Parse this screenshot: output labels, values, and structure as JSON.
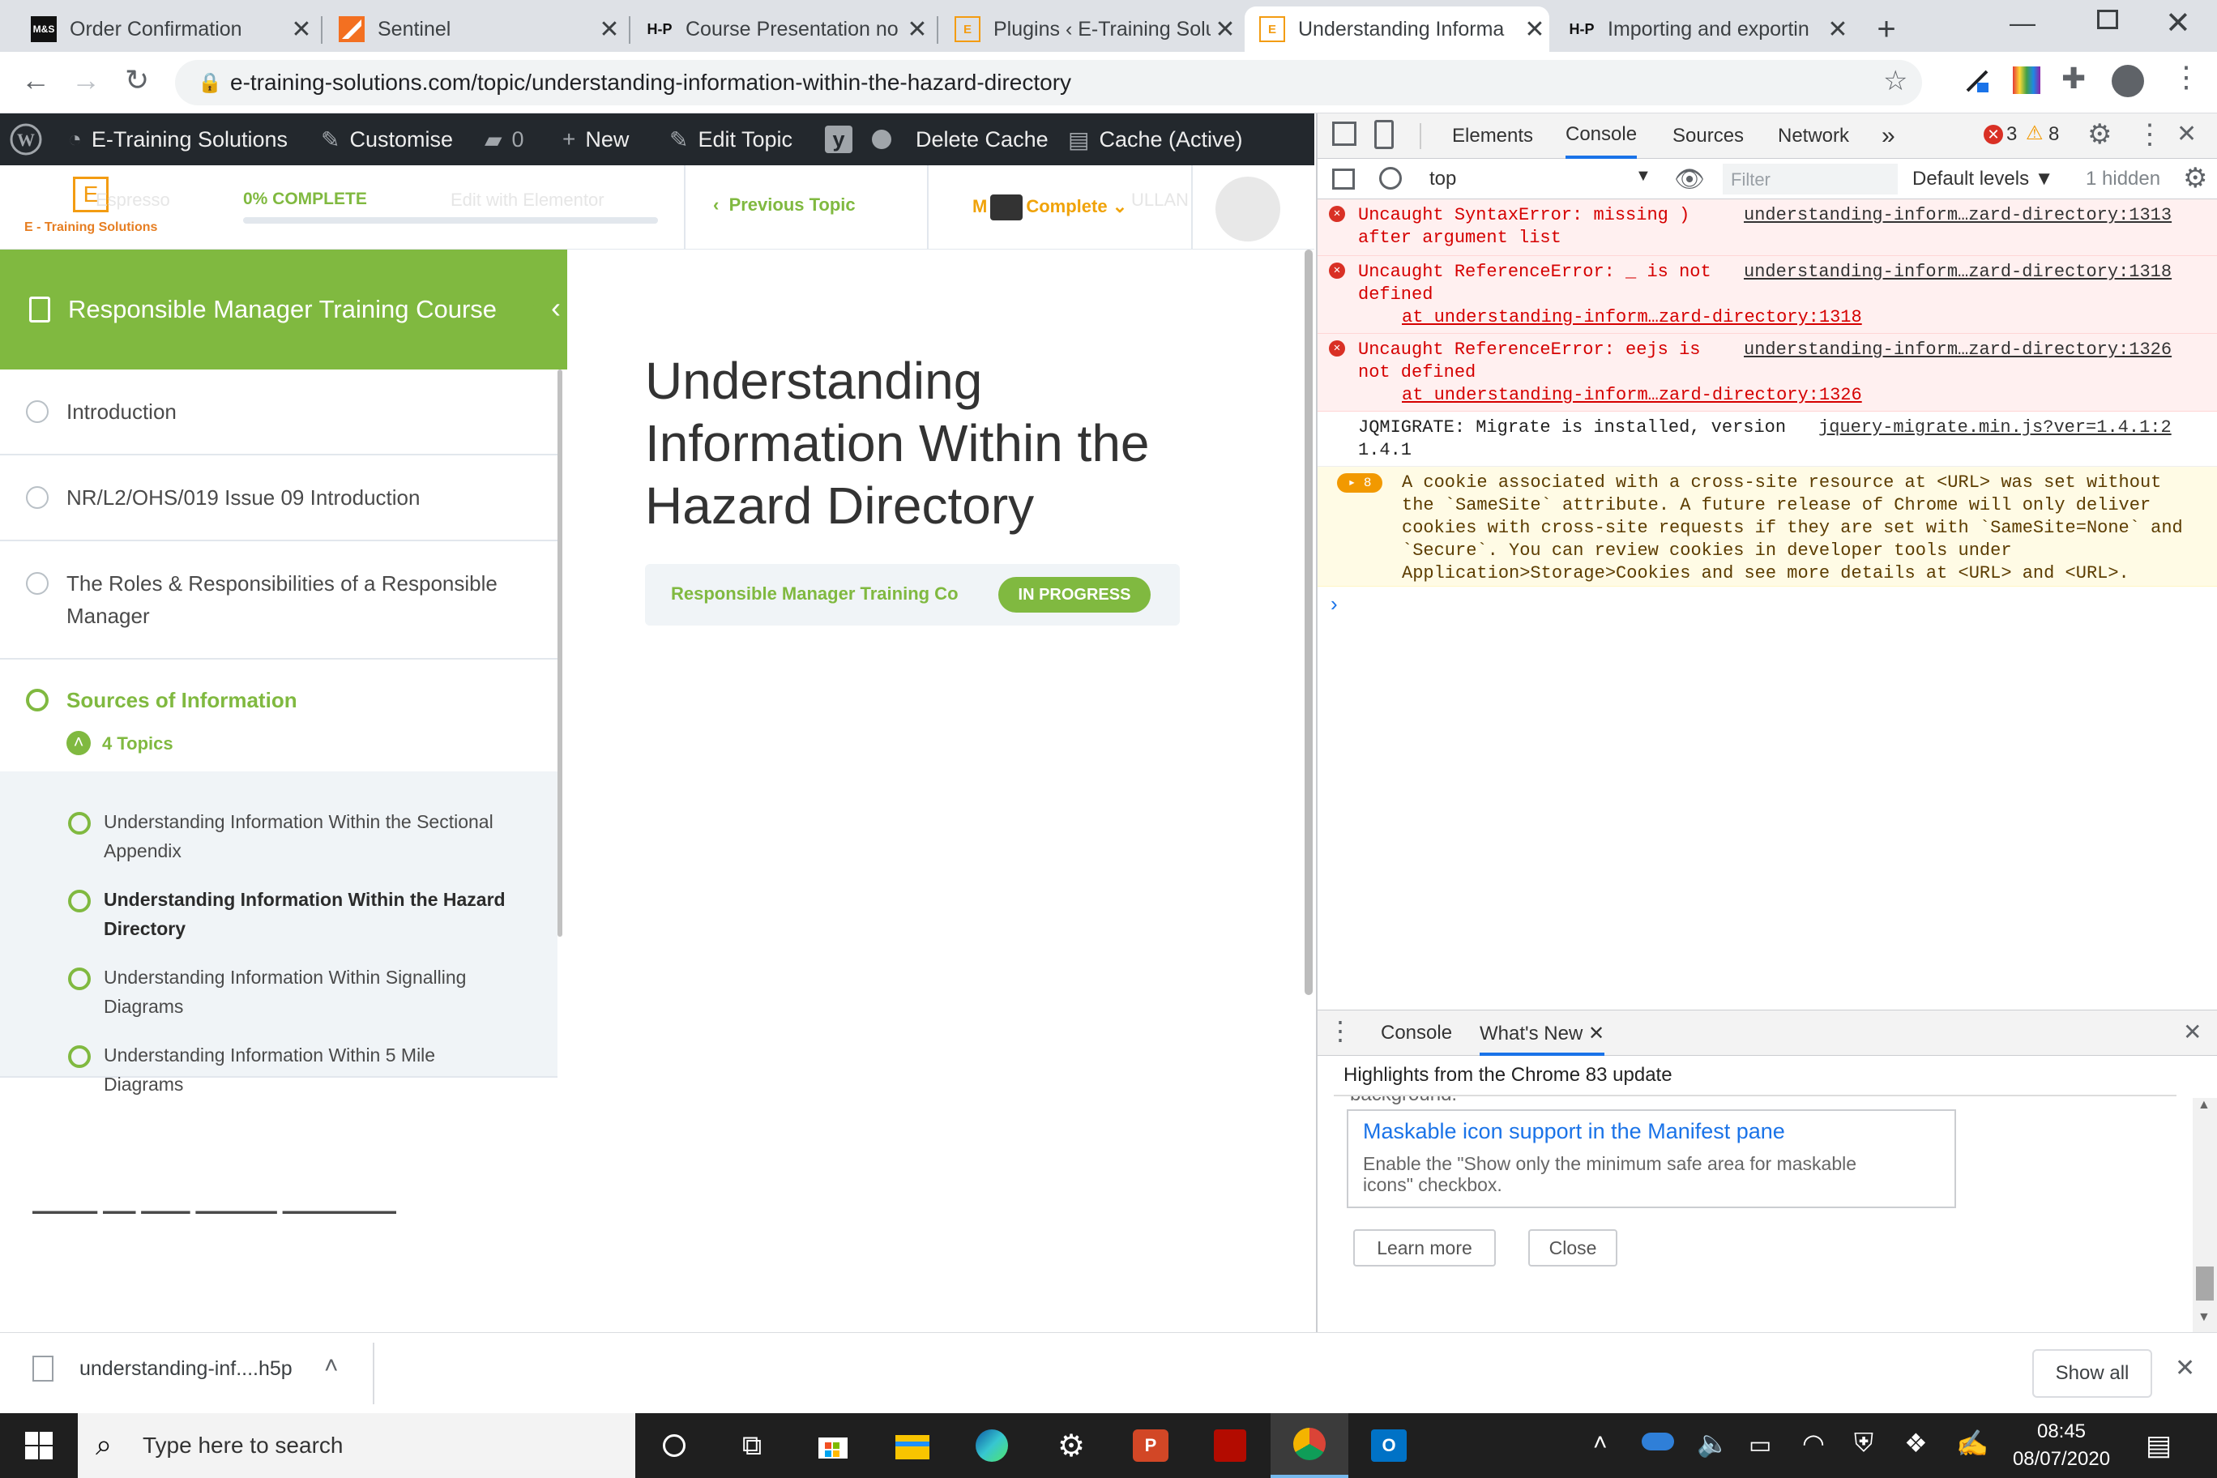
{
  "browser": {
    "tabs": [
      {
        "title": "Order Confirmation",
        "favicon": "M&S"
      },
      {
        "title": "Sentinel",
        "favicon": "sentinel-icon"
      },
      {
        "title": "Course Presentation no",
        "favicon": "H-P"
      },
      {
        "title": "Plugins ‹ E-Training Solu",
        "favicon": "E"
      },
      {
        "title": "Understanding Informa",
        "favicon": "E"
      },
      {
        "title": "Importing and exportin",
        "favicon": "H-P"
      }
    ],
    "url": "e-training-solutions.com/topic/understanding-information-within-the-hazard-directory"
  },
  "wp_admin_bar": {
    "site_name": "E-Training Solutions",
    "customise": "Customise",
    "comments_count": "0",
    "new": "New",
    "edit_topic": "Edit Topic",
    "delete_cache": "Delete Cache",
    "cache_active": "Cache (Active)"
  },
  "site_header": {
    "logo_text": "E - Training Solutions",
    "logo_letter": "E",
    "progress_label": "0% COMPLETE",
    "progress_value": 0,
    "previous_topic": "Previous Topic",
    "mark_complete": "Complete",
    "mark_prefix": "M",
    "ghost_espresso": "Espresso",
    "ghost_elementor": "Edit with Elementor",
    "ghost_user": "ULLAN"
  },
  "sidebar": {
    "course_title": "Responsible Manager Training Course",
    "lessons": [
      {
        "title": "Introduction"
      },
      {
        "title": "NR/L2/OHS/019 Issue 09 Introduction"
      },
      {
        "title_line1": "The Roles & Responsibilities of a Responsible",
        "title_line2": "Manager"
      },
      {
        "title": "Sources of Information",
        "topics_toggle": "4 Topics"
      }
    ],
    "topics": [
      {
        "line1": "Understanding Information Within the Sectional",
        "line2": "Appendix"
      },
      {
        "line1": "Understanding Information Within the Hazard",
        "line2": "Directory"
      },
      {
        "line1": "Understanding Information Within Signalling",
        "line2": "Diagrams"
      },
      {
        "line1": "Understanding Information Within 5 Mile",
        "line2": "Diagrams"
      }
    ]
  },
  "main": {
    "title_line1": "Understanding",
    "title_line2": "Information Within the",
    "title_line3": "Hazard Directory",
    "course_badge": "Responsible Manager Training Co",
    "status": "IN PROGRESS"
  },
  "devtools": {
    "tabs": [
      "Elements",
      "Console",
      "Sources",
      "Network"
    ],
    "error_count": "3",
    "warning_count": "8",
    "context": "top",
    "filter_placeholder": "Filter",
    "levels": "Default levels ▼",
    "hidden": "1 hidden",
    "messages": [
      {
        "type": "error",
        "line1": "Uncaught SyntaxError: missing )",
        "line2": "after argument list",
        "source": "understanding-inform…zard-directory:1313"
      },
      {
        "type": "error",
        "line1": "Uncaught ReferenceError: _ is not",
        "line2": "defined",
        "at": "at understanding-inform…zard-directory:1318",
        "source": "understanding-inform…zard-directory:1318"
      },
      {
        "type": "error",
        "line1": "Uncaught ReferenceError: eejs is",
        "line2": "not defined",
        "at": "at understanding-inform…zard-directory:1326",
        "source": "understanding-inform…zard-directory:1326"
      },
      {
        "type": "log",
        "line1": "JQMIGRATE: Migrate is installed, version",
        "line2": "1.4.1",
        "source": "jquery-migrate.min.js?ver=1.4.1:2"
      },
      {
        "type": "warning",
        "count": "8",
        "lines": [
          "A cookie associated with a cross-site resource at <URL> was set without",
          "the `SameSite` attribute. A future release of Chrome will only deliver",
          "cookies with cross-site requests if they are set with `SameSite=None` and",
          "`Secure`. You can review cookies in developer tools under",
          "Application>Storage>Cookies and see more details at <URL> and <URL>."
        ]
      }
    ],
    "drawer": {
      "tabs": [
        "Console",
        "What's New"
      ],
      "heading": "Highlights from the Chrome 83 update",
      "cut_text": "background.",
      "card_title": "Maskable icon support in the Manifest pane",
      "card_line1": "Enable the \"Show only the minimum safe area for maskable",
      "card_line2": "icons\" checkbox.",
      "learn_more": "Learn more",
      "close": "Close"
    }
  },
  "download_bar": {
    "filename": "understanding-inf....h5p",
    "show_all": "Show all"
  },
  "taskbar": {
    "search_placeholder": "Type here to search",
    "time": "08:45",
    "date": "08/07/2020"
  }
}
